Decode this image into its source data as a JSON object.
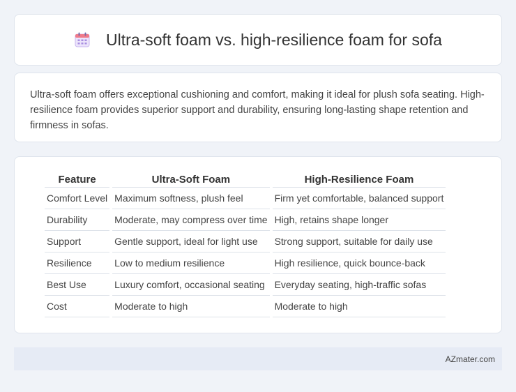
{
  "header": {
    "title": "Ultra-soft foam vs. high-resilience foam for sofa",
    "icon": "calendar-icon"
  },
  "description": "Ultra-soft foam offers exceptional cushioning and comfort, making it ideal for plush sofa seating. High-resilience foam provides superior support and durability, ensuring long-lasting shape retention and firmness in sofas.",
  "table": {
    "headers": [
      "Feature",
      "Ultra-Soft Foam",
      "High-Resilience Foam"
    ],
    "rows": [
      [
        "Comfort Level",
        "Maximum softness, plush feel",
        "Firm yet comfortable, balanced support"
      ],
      [
        "Durability",
        "Moderate, may compress over time",
        "High, retains shape longer"
      ],
      [
        "Support",
        "Gentle support, ideal for light use",
        "Strong support, suitable for daily use"
      ],
      [
        "Resilience",
        "Low to medium resilience",
        "High resilience, quick bounce-back"
      ],
      [
        "Best Use",
        "Luxury comfort, occasional seating",
        "Everyday seating, high-traffic sofas"
      ],
      [
        "Cost",
        "Moderate to high",
        "Moderate to high"
      ]
    ]
  },
  "footer": {
    "site": "AZmater.com"
  },
  "colors": {
    "background": "#f0f3f8",
    "footer_bg": "#e6ebf5",
    "icon_accent": "#b9a2e8"
  }
}
